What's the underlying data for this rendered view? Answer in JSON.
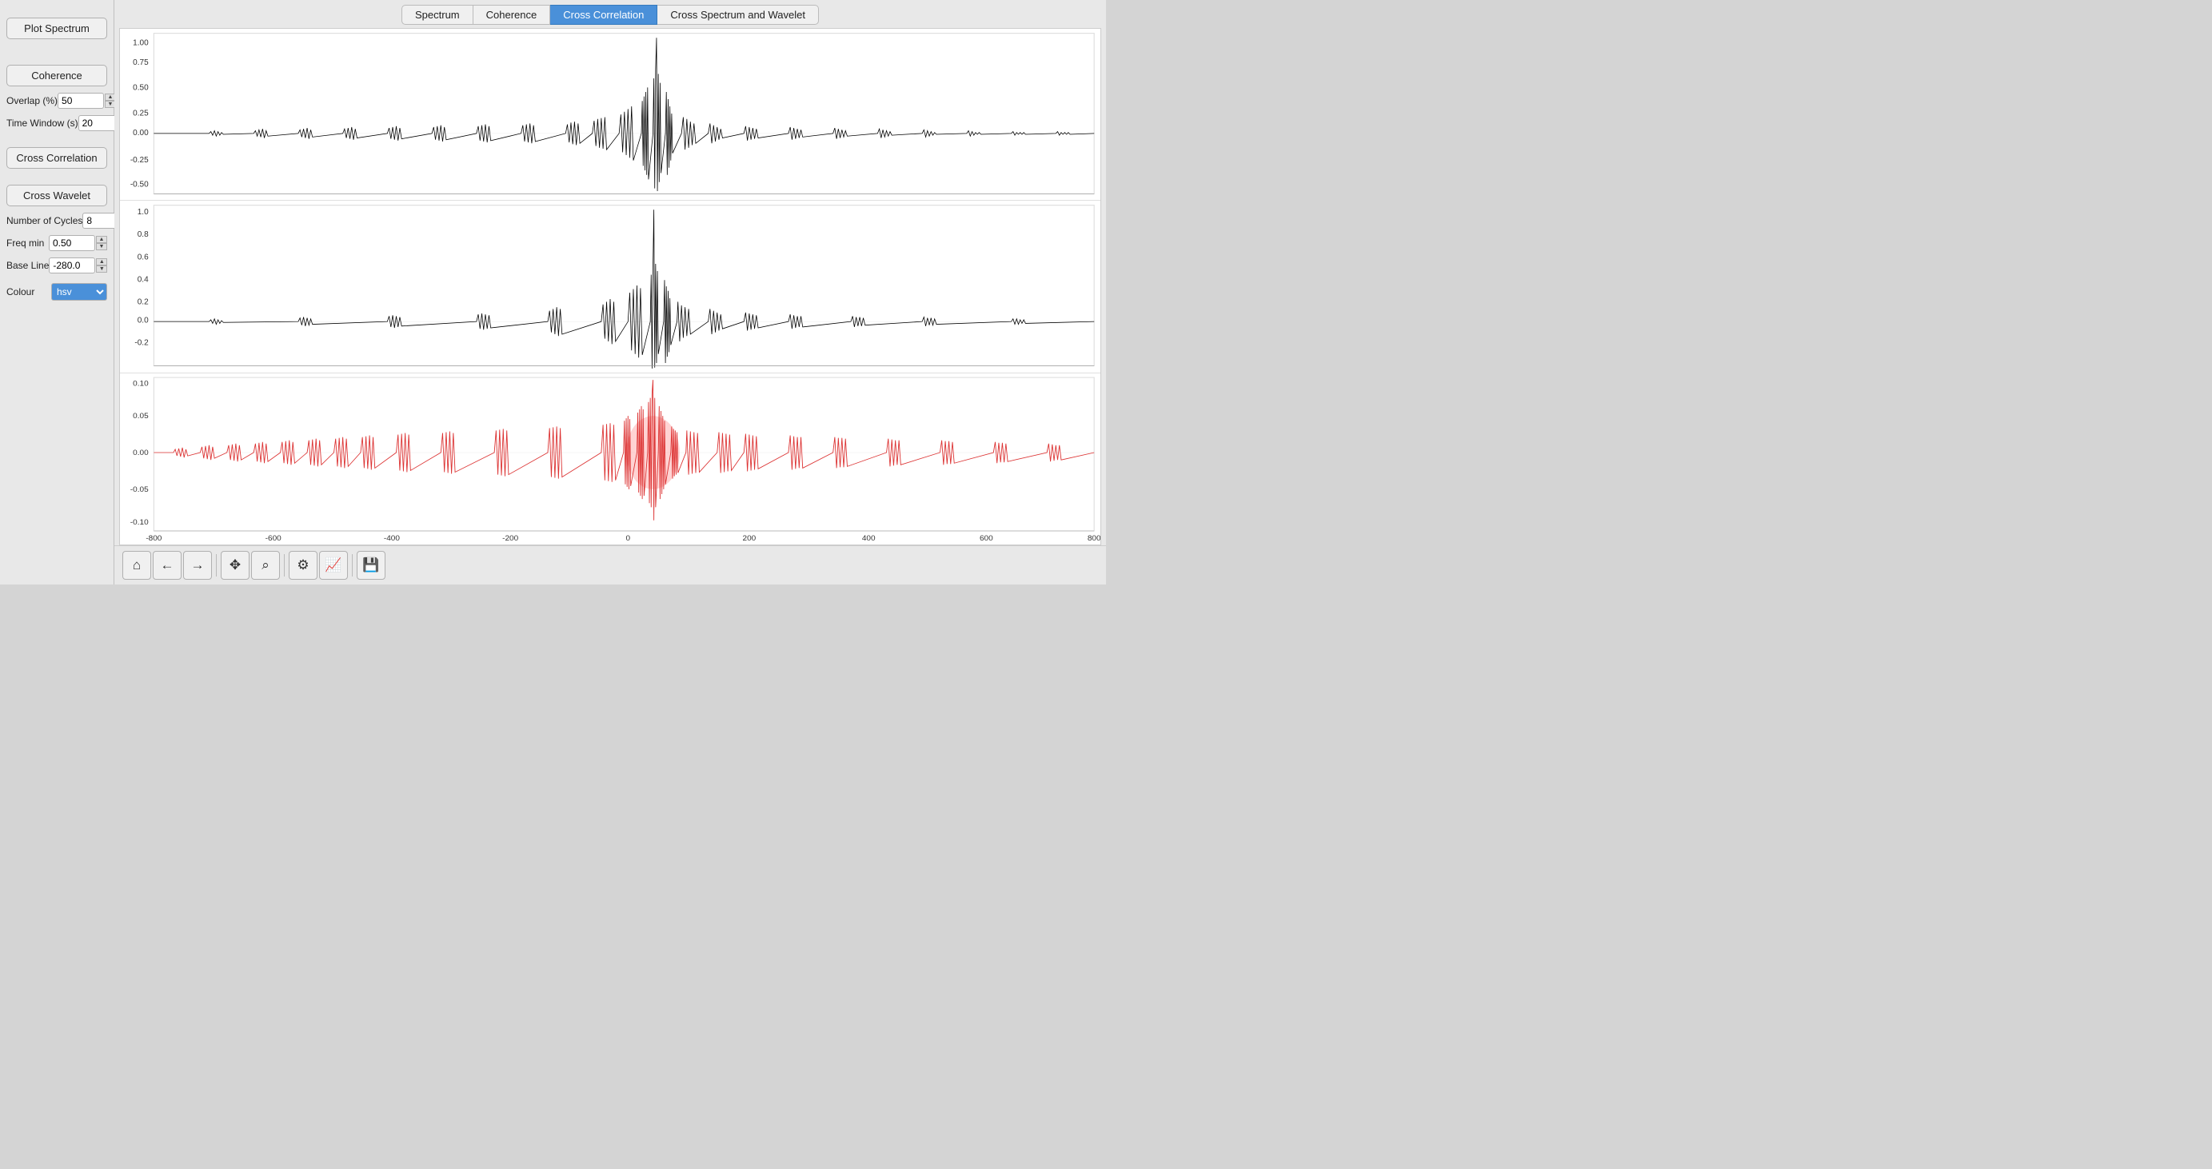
{
  "tabs": [
    {
      "label": "Spectrum",
      "active": false
    },
    {
      "label": "Coherence",
      "active": false
    },
    {
      "label": "Cross Correlation",
      "active": true
    },
    {
      "label": "Cross Spectrum and Wavelet",
      "active": false
    }
  ],
  "sidebar": {
    "buttons": [
      {
        "label": "Plot Spectrum",
        "name": "plot-spectrum-btn"
      },
      {
        "label": "Coherence",
        "name": "coherence-btn"
      },
      {
        "label": "Cross Correlation",
        "name": "cross-correlation-btn"
      },
      {
        "label": "Cross Wavelet",
        "name": "cross-wavelet-btn"
      }
    ],
    "fields": [
      {
        "label": "Overlap (%)",
        "value": "50",
        "name": "overlap-input"
      },
      {
        "label": "Time Window (s)",
        "value": "20",
        "name": "time-window-input"
      },
      {
        "label": "Number of Cycles",
        "value": "8",
        "name": "num-cycles-input"
      },
      {
        "label": "Freq min",
        "value": "0.50",
        "name": "freq-min-input"
      },
      {
        "label": "Base Line",
        "value": "-280.0",
        "name": "base-line-input"
      }
    ],
    "colour_label": "Colour",
    "colour_value": "hsv"
  },
  "charts": [
    {
      "name": "chart-top",
      "y_labels": [
        "1.00",
        "0.75",
        "0.50",
        "0.25",
        "0.00",
        "-0.25",
        "-0.50"
      ],
      "color": "black"
    },
    {
      "name": "chart-middle",
      "y_labels": [
        "1.0",
        "0.8",
        "0.6",
        "0.4",
        "0.2",
        "0.0",
        "-0.2"
      ],
      "color": "black"
    },
    {
      "name": "chart-bottom",
      "y_labels": [
        "0.10",
        "0.05",
        "0.00",
        "-0.05",
        "-0.10"
      ],
      "color": "red"
    }
  ],
  "x_axis_labels": [
    "-800",
    "-600",
    "-400",
    "-200",
    "0",
    "200",
    "400",
    "600",
    "800"
  ],
  "toolbar": {
    "buttons": [
      {
        "label": "⌂",
        "name": "home-btn",
        "icon": "home-icon"
      },
      {
        "label": "←",
        "name": "back-btn",
        "icon": "back-icon"
      },
      {
        "label": "→",
        "name": "forward-btn",
        "icon": "forward-icon"
      },
      {
        "label": "✥",
        "name": "pan-btn",
        "icon": "pan-icon"
      },
      {
        "label": "🔍",
        "name": "zoom-btn",
        "icon": "zoom-icon"
      },
      {
        "label": "⚙",
        "name": "settings-btn",
        "icon": "settings-icon"
      },
      {
        "label": "📈",
        "name": "chart-btn",
        "icon": "chart-icon"
      },
      {
        "label": "💾",
        "name": "save-btn",
        "icon": "save-icon"
      }
    ]
  }
}
